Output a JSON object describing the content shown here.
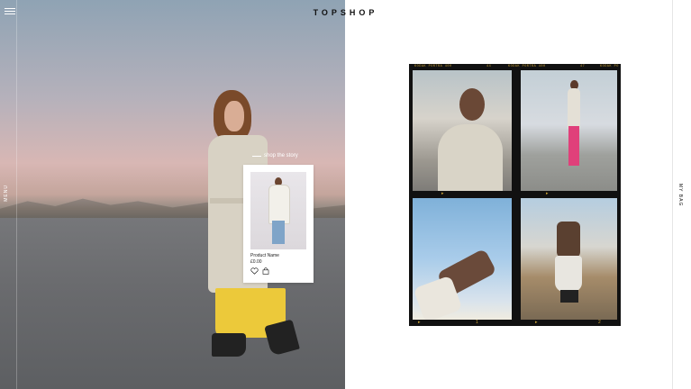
{
  "header": {
    "brand": "TOPSHOP",
    "menu_label": "MENU",
    "bag_label": "MY BAG"
  },
  "hero": {
    "shop_story": "shop the story"
  },
  "product_card": {
    "name": "Product Name",
    "price": "£0.00",
    "icons": [
      "heart-icon",
      "bag-icon"
    ]
  },
  "film": {
    "edge_labels": [
      "KODAK PORTRA 400",
      "44",
      "KODAK PORTRA 400",
      "47",
      "KODAK PO"
    ],
    "sprocket_marks": [
      "▸",
      "▸",
      "▸",
      "▸"
    ],
    "frame_numbers": [
      "1",
      "2"
    ]
  },
  "colors": {
    "accent_yellow": "#ecc93a",
    "film_edge": "#c9a035",
    "brand_text": "#111111"
  }
}
